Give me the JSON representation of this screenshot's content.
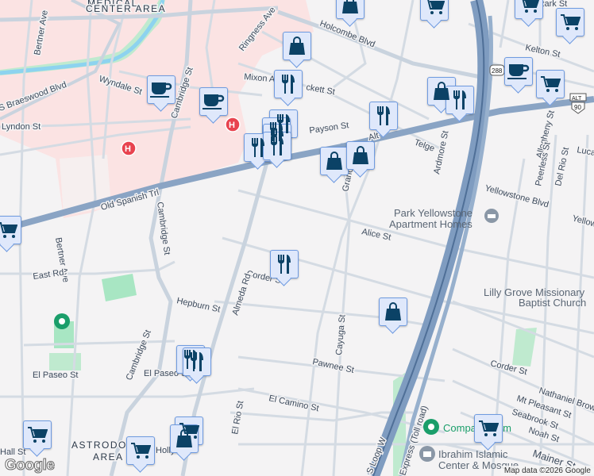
{
  "areas": {
    "medical": [
      "MEDICAL",
      "CENTER AREA"
    ],
    "astrodome": [
      "ASTRODOME",
      "AREA"
    ]
  },
  "streets": {
    "braeswood": "S Braeswood Blvd",
    "bertner": "Bertner Ave",
    "bertner2": "Bertner Ave",
    "wyndale": "Wyndale St",
    "lyndon": "Lyndon St",
    "cambridge": "Cambridge St",
    "cambridge2": "Cambridge St",
    "cambridge3": "Cambridge St",
    "ringness": "Ringness Ave",
    "mixon": "Mixon A",
    "holcombe": "Holcombe Blvd",
    "crockett": "ckett St",
    "payson": "Payson St",
    "alt": "Alt",
    "telge": "Telge",
    "ardmore": "Ardmore St",
    "grand": "Grand",
    "oldspanish": "Old Spanish Trl",
    "yellowstone": "Yellowstone Blvd",
    "yellow2": "Yellow",
    "alice": "Alice St",
    "kelton": "Kelton St",
    "allegheny": "Allegheny St",
    "peerless": "Peerless St",
    "delrio": "Del Rio St",
    "luca": "Luca",
    "eastrd": "East Rd",
    "corder": "Corder St",
    "corder2": "Corder St",
    "hepburn": "Hepburn St",
    "almeda": "Almeda Rd",
    "elpaseo": "El Paseo St",
    "elpaseo2": "El Paseo St",
    "cayuga": "Cayuga St",
    "pawnee": "Pawnee St",
    "elcamino": "El Camino St",
    "elrio": "El Rio St",
    "nathaniel": "Nathaniel Brown",
    "mtpleasant": "Mt Pleasant St",
    "seabrook": "Seabrook St",
    "noah": "Noah St",
    "mainer": "Mainer St",
    "sloop": "S Loop W",
    "express": "Express (Toll road)",
    "hall": "Hall St",
    "holly": "Holly St",
    "ozark": "zark St",
    "ampa": "ampa"
  },
  "shields": {
    "hwy288": "288",
    "alt": "ALT",
    "us90": "90"
  },
  "pois": {
    "park_yellowstone": [
      "Park Yellowstone",
      "Apartment Homes"
    ],
    "lilly_grove": [
      "Lilly Grove Missionary",
      "Baptist Church"
    ],
    "gym": "Compass Gym",
    "mosque": [
      "Ibrahim Islamic",
      "Center & Mosque"
    ]
  },
  "markers": [
    {
      "type": "shopping-bag"
    },
    {
      "type": "grocery-cart"
    },
    {
      "type": "shopping-bag"
    },
    {
      "type": "restaurant"
    },
    {
      "type": "coffee"
    },
    {
      "type": "coffee"
    },
    {
      "type": "restaurant"
    },
    {
      "type": "restaurant"
    },
    {
      "type": "restaurant"
    },
    {
      "type": "restaurant"
    },
    {
      "type": "restaurant"
    },
    {
      "type": "shopping-bag"
    },
    {
      "type": "shopping-bag"
    },
    {
      "type": "restaurant"
    },
    {
      "type": "shopping-bag"
    },
    {
      "type": "restaurant"
    },
    {
      "type": "grocery-cart"
    },
    {
      "type": "grocery-cart"
    },
    {
      "type": "coffee"
    },
    {
      "type": "grocery-cart"
    },
    {
      "type": "grocery-cart"
    },
    {
      "type": "restaurant"
    },
    {
      "type": "shopping-bag"
    },
    {
      "type": "restaurant"
    },
    {
      "type": "restaurant"
    },
    {
      "type": "grocery-cart"
    },
    {
      "type": "grocery-cart"
    },
    {
      "type": "grocery-cart"
    },
    {
      "type": "shopping-bag"
    },
    {
      "type": "grocery-cart"
    }
  ],
  "hospital_label": "H",
  "logo": "Google",
  "attribution": "Map data ©2026 Google",
  "colors": {
    "marker_fill": "#dfe8fb",
    "marker_border": "#6f9be0",
    "icon": "#0b4266",
    "freeway": "#7f9cc0",
    "medical_area": "#fbe3e3",
    "park": "#a8e6c3",
    "hospital": "#e8434f"
  }
}
